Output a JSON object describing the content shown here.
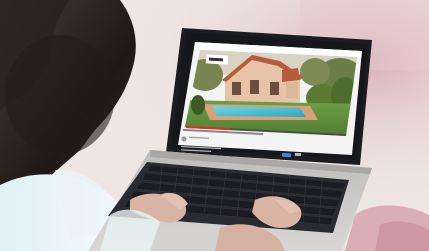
{
  "scene": {
    "subject": "person-using-laptop",
    "colors": {
      "wall": "#efe6e3",
      "pink_glow": "#d7aab3",
      "hair": "#1f1814",
      "skin": "#d9b3a4",
      "laptop_silver": "#c9c7c6",
      "screen_bezel": "#15171b",
      "keyboard_key": "#1e1f24",
      "pool": "#4ec7d8",
      "lawn": "#5d8f3a",
      "house_roof": "#b65b3c",
      "house_wall": "#e7c4a7",
      "sky": "#d9d3c6",
      "subscribe_red": "#e52d27",
      "play_blue": "#3e86d9"
    }
  },
  "video_page": {
    "logo_text": "",
    "title_text": "",
    "channel_text": "",
    "description_text": ""
  }
}
